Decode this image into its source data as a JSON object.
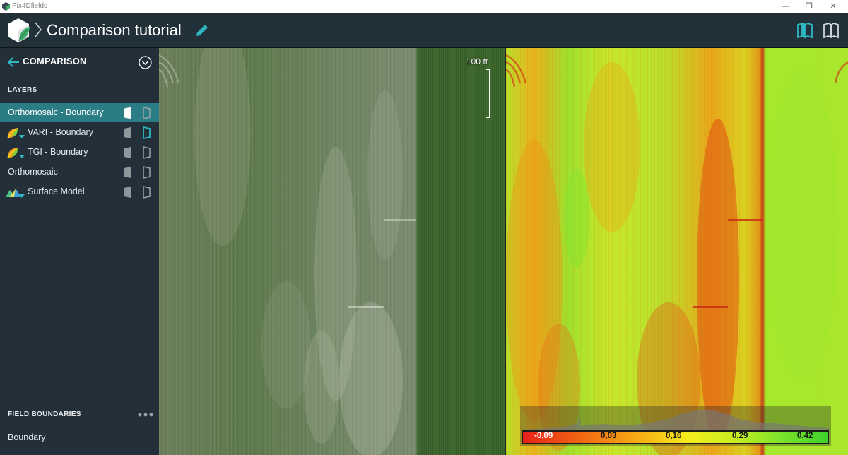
{
  "window": {
    "app_name": "Pix4Dfields",
    "minimize": "—",
    "restore": "❐",
    "close": "✕"
  },
  "header": {
    "project_title": "Comparison tutorial",
    "edit_icon": "pencil-icon",
    "split_view_icon": "split-view-icon",
    "single_view_icon": "map-book-icon"
  },
  "sidebar": {
    "title": "COMPARISON",
    "layers_label": "LAYERS",
    "layers": [
      {
        "name": "Orthomosaic - Boundary",
        "icon": "",
        "active": true
      },
      {
        "name": "VARI - Boundary",
        "icon": "leaf-index-icon",
        "active": false
      },
      {
        "name": "TGI - Boundary",
        "icon": "leaf-index-icon",
        "active": false
      },
      {
        "name": "Orthomosaic",
        "icon": "",
        "active": false
      },
      {
        "name": "Surface Model",
        "icon": "terrain-icon",
        "active": false
      }
    ],
    "field_boundaries_label": "FIELD BOUNDARIES",
    "boundary_item": "Boundary"
  },
  "map": {
    "scale_label": "100 ft",
    "legend_ticks": [
      "-0,09",
      "0,03",
      "0,16",
      "0,29",
      "0,42"
    ],
    "colors": {
      "low": "#e8201a",
      "mid": "#f3ee1d",
      "high": "#3fd12c",
      "accent": "#2b7d85"
    }
  }
}
